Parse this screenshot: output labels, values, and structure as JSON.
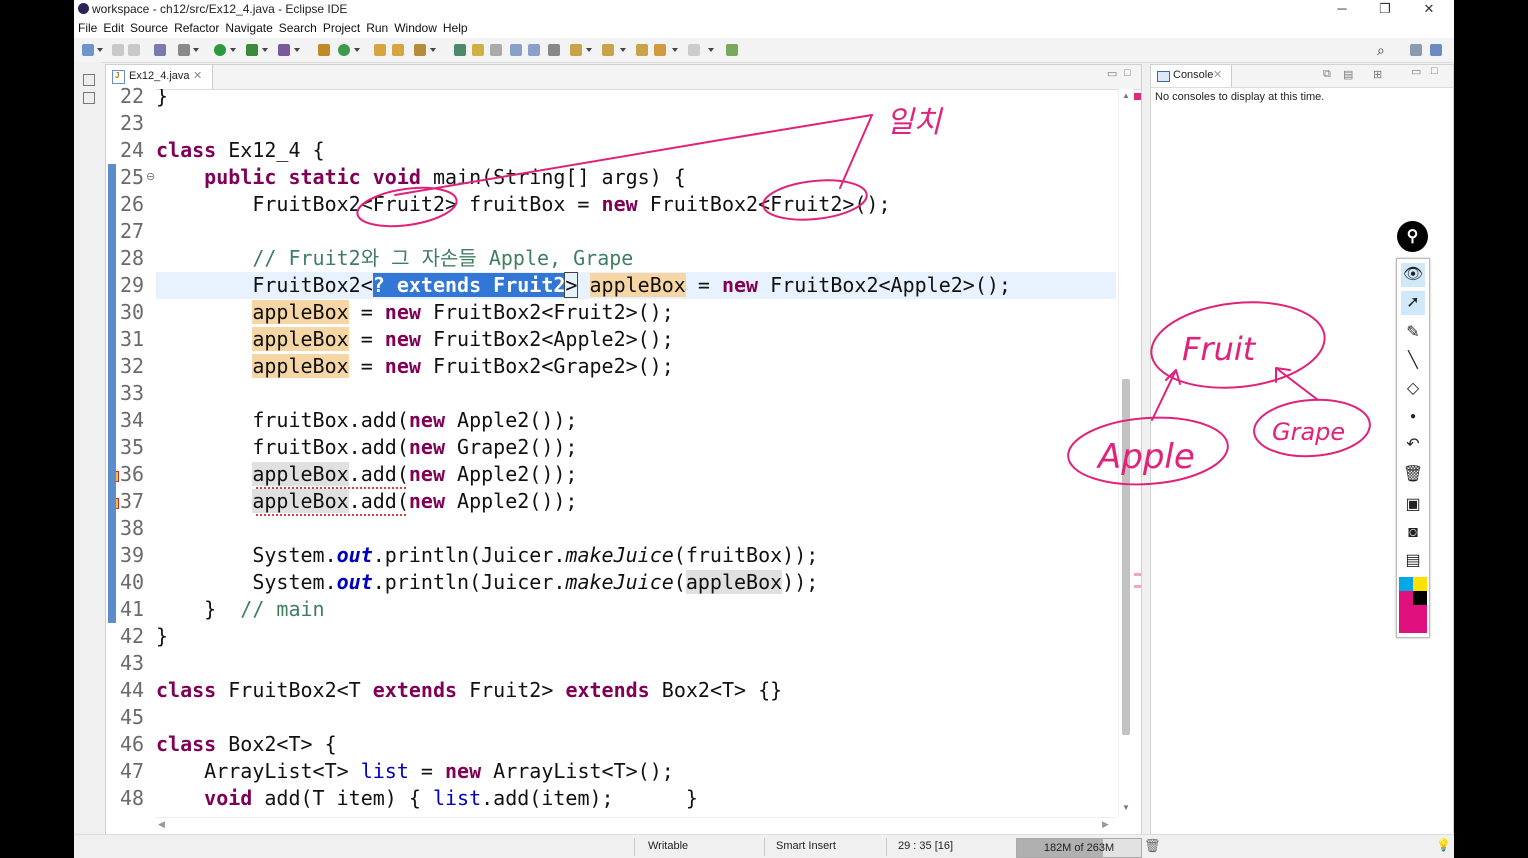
{
  "window": {
    "title": "workspace - ch12/src/Ex12_4.java - Eclipse IDE",
    "controls": {
      "minimize": "─",
      "restore": "❐",
      "close": "✕"
    }
  },
  "menu": [
    "File",
    "Edit",
    "Source",
    "Refactor",
    "Navigate",
    "Search",
    "Project",
    "Run",
    "Window",
    "Help"
  ],
  "editor": {
    "tab_label": "Ex12_4.java",
    "tab_close": "✕",
    "tab_icon_letter": "J",
    "lines": [
      {
        "n": "22",
        "text": "}"
      },
      {
        "n": "23",
        "text": ""
      },
      {
        "n": "24",
        "text": "class Ex12_4 {"
      },
      {
        "n": "25",
        "text": "    public static void main(String[] args) {"
      },
      {
        "n": "26",
        "text": "        FruitBox2<Fruit2> fruitBox = new FruitBox2<Fruit2>();"
      },
      {
        "n": "27",
        "text": ""
      },
      {
        "n": "28",
        "text": "        // Fruit2와 그 자손들 Apple, Grape"
      },
      {
        "n": "29",
        "text": "        FruitBox2<? extends Fruit2> appleBox = new FruitBox2<Apple2>();"
      },
      {
        "n": "30",
        "text": "        appleBox = new FruitBox2<Fruit2>();"
      },
      {
        "n": "31",
        "text": "        appleBox = new FruitBox2<Apple2>();"
      },
      {
        "n": "32",
        "text": "        appleBox = new FruitBox2<Grape2>();"
      },
      {
        "n": "33",
        "text": ""
      },
      {
        "n": "34",
        "text": "        fruitBox.add(new Apple2());"
      },
      {
        "n": "35",
        "text": "        fruitBox.add(new Grape2());"
      },
      {
        "n": "36",
        "text": "        appleBox.add(new Apple2());"
      },
      {
        "n": "37",
        "text": "        appleBox.add(new Apple2());"
      },
      {
        "n": "38",
        "text": ""
      },
      {
        "n": "39",
        "text": "        System.out.println(Juicer.makeJuice(fruitBox));"
      },
      {
        "n": "40",
        "text": "        System.out.println(Juicer.makeJuice(appleBox));"
      },
      {
        "n": "41",
        "text": "    }  // main"
      },
      {
        "n": "42",
        "text": "}"
      },
      {
        "n": "43",
        "text": ""
      },
      {
        "n": "44",
        "text": "class FruitBox2<T extends Fruit2> extends Box2<T> {}"
      },
      {
        "n": "45",
        "text": ""
      },
      {
        "n": "46",
        "text": "class Box2<T> {"
      },
      {
        "n": "47",
        "text": "    ArrayList<T> list = new ArrayList<T>();"
      },
      {
        "n": "48",
        "text": "    void add(T item) { list.add(item);      }"
      }
    ],
    "current_line": "29",
    "error_lines": [
      "36",
      "37"
    ],
    "fold_marker": "⊖"
  },
  "console": {
    "tab_label": "Console",
    "tab_close": "✕",
    "message": "No consoles to display at this time."
  },
  "status": {
    "writable": "Writable",
    "insert_mode": "Smart Insert",
    "position": "29 : 35 [16]",
    "heap": "182M of 263M",
    "heap_used_fraction": 0.69
  },
  "annotations": {
    "korean_note": "일치",
    "fruit": "Fruit",
    "apple": "Apple",
    "grape": "Grape",
    "pen_color": "#e0227a"
  },
  "pen_toolbar": {
    "tools": [
      "pin-icon",
      "eye-icon",
      "pointer-icon",
      "highlighter-icon",
      "pen-icon",
      "eraser-icon",
      "dot-icon",
      "undo-icon",
      "trash-icon",
      "whiteboard-icon",
      "camera-icon",
      "clipboard-icon"
    ],
    "colors": [
      "#00a8e8",
      "#ffe000",
      "#e0117f",
      "#000000"
    ]
  },
  "colors": {
    "keyword": "#7f0055",
    "comment": "#3f7f5f",
    "field": "#0000c0",
    "selection": "#3277d6",
    "occurrence": "#f5d6a4",
    "current_line": "#e8f2fe"
  }
}
